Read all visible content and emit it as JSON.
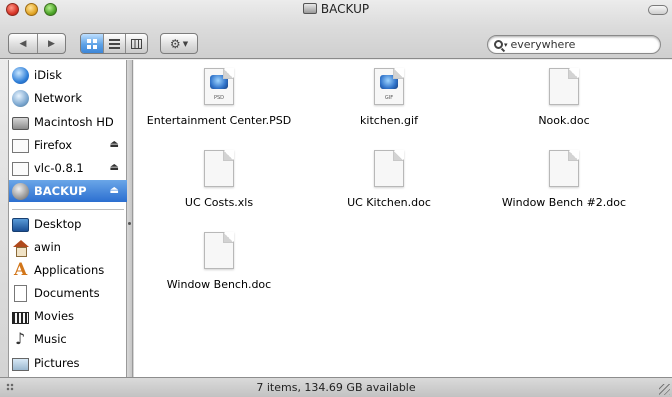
{
  "window": {
    "title": "BACKUP"
  },
  "toolbar": {
    "back_icon": "◀",
    "forward_icon": "▶",
    "view_icons": "icon-view",
    "view_list": "list-view",
    "view_columns": "column-view",
    "action_icon": "gear-icon",
    "search_placeholder": "everywhere"
  },
  "sidebar": {
    "items": [
      {
        "label": "iDisk",
        "icon": "idisk-icon"
      },
      {
        "label": "Network",
        "icon": "network-icon"
      },
      {
        "label": "Macintosh HD",
        "icon": "hard-disk-icon"
      },
      {
        "label": "Firefox",
        "icon": "disk-image-icon",
        "eject": true
      },
      {
        "label": "vlc-0.8.1",
        "icon": "disk-image-icon",
        "eject": true
      },
      {
        "label": "BACKUP",
        "icon": "backup-disk-icon",
        "eject": true,
        "selected": true
      },
      {
        "label": "Desktop",
        "icon": "desktop-icon"
      },
      {
        "label": "awin",
        "icon": "home-icon"
      },
      {
        "label": "Applications",
        "icon": "applications-icon"
      },
      {
        "label": "Documents",
        "icon": "documents-icon"
      },
      {
        "label": "Movies",
        "icon": "movies-icon"
      },
      {
        "label": "Music",
        "icon": "music-icon"
      },
      {
        "label": "Pictures",
        "icon": "pictures-icon"
      }
    ],
    "eject_symbol": "⏏"
  },
  "files": [
    {
      "name": "Entertainment Center.PSD",
      "kind": "psd",
      "tag": "PSD"
    },
    {
      "name": "kitchen.gif",
      "kind": "gif",
      "tag": "GIF"
    },
    {
      "name": "Nook.doc",
      "kind": "doc"
    },
    {
      "name": "UC Costs.xls",
      "kind": "doc"
    },
    {
      "name": "UC Kitchen.doc",
      "kind": "doc"
    },
    {
      "name": "Window Bench #2.doc",
      "kind": "doc"
    },
    {
      "name": "Window Bench.doc",
      "kind": "doc"
    }
  ],
  "status": {
    "text": "7 items, 134.69 GB available"
  }
}
